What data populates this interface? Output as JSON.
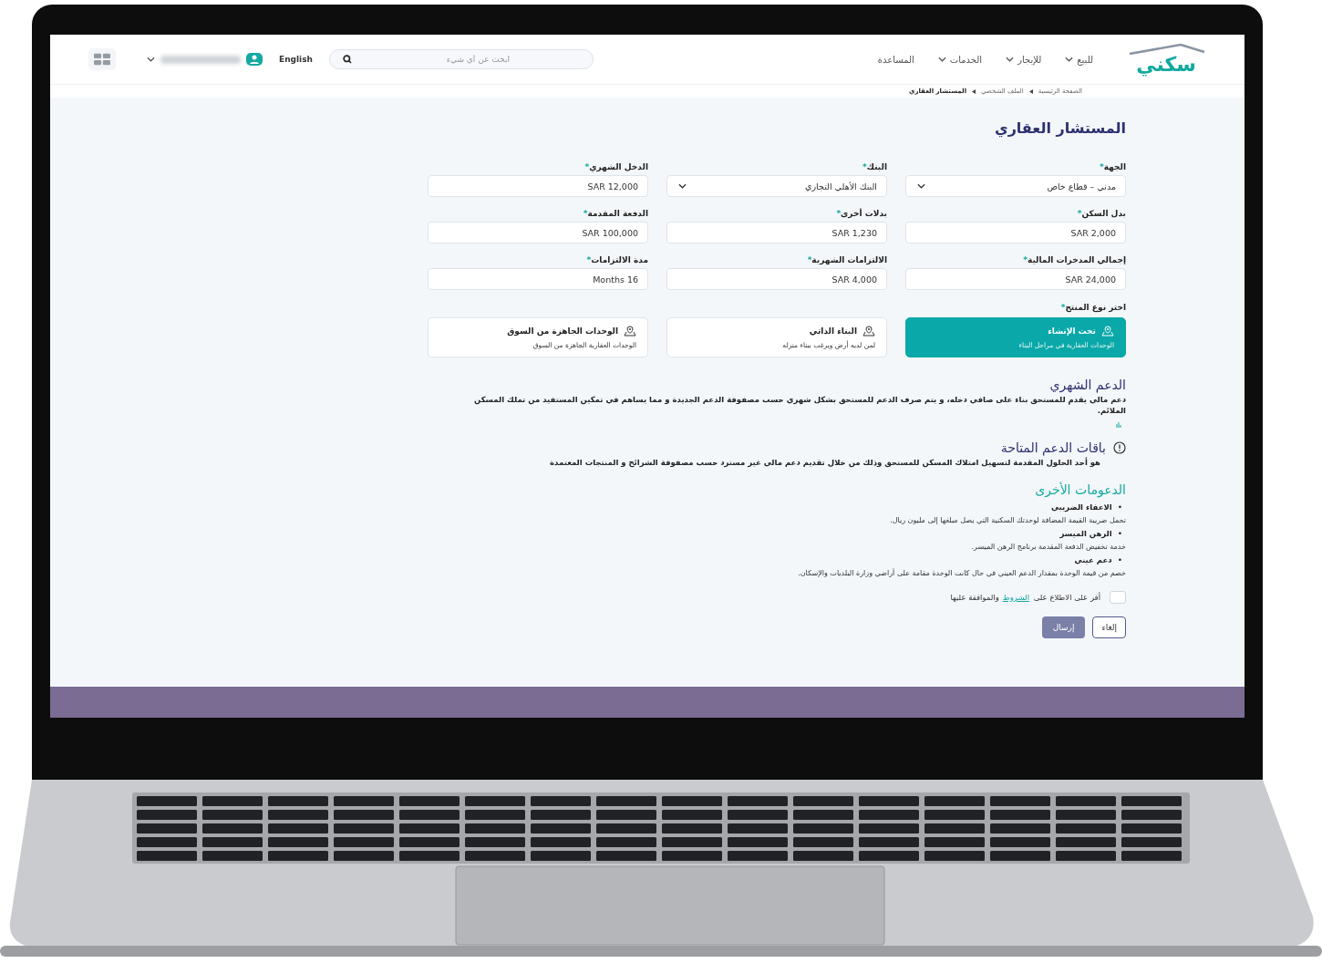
{
  "header": {
    "logo": "سكني",
    "nav": [
      {
        "label": "للبيع",
        "dropdown": true
      },
      {
        "label": "للإيجار",
        "dropdown": true
      },
      {
        "label": "الخدمات",
        "dropdown": true
      },
      {
        "label": "المساعدة",
        "dropdown": false
      }
    ],
    "search": {
      "placeholder": "ابحث عن أي شيء"
    },
    "language": "English"
  },
  "breadcrumb": [
    {
      "label": "الصفحة الرئيسية",
      "current": false
    },
    {
      "label": "الملف الشخصي",
      "current": false
    },
    {
      "label": "المستشار العقاري",
      "current": true
    }
  ],
  "title": "المستشار العقاري",
  "required_mark": "*",
  "fields": [
    {
      "label": "الجهة",
      "value": "مدني – قطاع خاص",
      "kind": "select"
    },
    {
      "label": "البنك",
      "value": "البنك الأهلي التجاري",
      "kind": "select"
    },
    {
      "label": "الدخل الشهري",
      "value": "SAR 12,000",
      "kind": "text"
    },
    {
      "label": "بدل السكن",
      "value": "SAR 2,000",
      "kind": "text"
    },
    {
      "label": "بدلات أخرى",
      "value": "SAR 1,230",
      "kind": "text"
    },
    {
      "label": "الدفعة المقدمة",
      "value": "SAR 100,000",
      "kind": "text"
    },
    {
      "label": "إجمالي المدخرات المالية",
      "value": "SAR 24,000",
      "kind": "text"
    },
    {
      "label": "الالتزامات الشهرية",
      "value": "SAR 4,000",
      "kind": "text"
    },
    {
      "label": "مدة الالتزامات",
      "value": "Months 16",
      "kind": "text"
    }
  ],
  "product_label": "اختر نوع المنتج",
  "products": [
    {
      "title": "تحت الإنشاء",
      "subtitle": "الوحدات العقارية في مراحل البناء",
      "selected": true
    },
    {
      "title": "البناء الذاتي",
      "subtitle": "لمن لديه أرض ويرغب ببناء منزله",
      "selected": false
    },
    {
      "title": "الوحدات الجاهزة من السوق",
      "subtitle": "الوحدات العقارية الجاهزة من السوق",
      "selected": false
    }
  ],
  "monthly_support": {
    "title": "الدعم الشهري",
    "text": "دعم مالي يقدم للمستحق بناء على صافي دخله، و يتم صرف الدعم للمستحق بشكل شهري حسب مصفوفة الدعم الجديدة و مما يساهم في تمكين المستفيد من تملك المسكن الملائم."
  },
  "packages": {
    "title": "باقات الدعم المتاحة",
    "text": "هو أحد الحلول المقدمة لتسهيل امتلاك المسكن للمستحق وذلك من خلال تقديم دعم مالي غير مسترد حسب مصفوفة الشرائح و المنتجات المعتمدة"
  },
  "other_support": {
    "title": "الدعومات الأخرى",
    "marker": "•",
    "items": [
      {
        "title": "الاعفاء الضريبي",
        "text": "تحمل ضريبة القيمة المضافة لوحدتك السكنية التي يصل مبلغها إلى مليون ريال."
      },
      {
        "title": "الرهن الميسر",
        "text": "خدمة تخفيض الدفعة المقدمة برنامج الرهن الميسر."
      },
      {
        "title": "دعم عيني",
        "text": "خصم من قيمة الوحدة بمقدار الدعم العيني في حال كانت الوحدة مقامة على أراضي وزارة البلديات والإسكان."
      }
    ]
  },
  "terms": {
    "checked": false,
    "before": "أقر على الاطلاع على ",
    "link": "الشروط",
    "after": "والموافقة عليها"
  },
  "buttons": {
    "submit": "إرسال",
    "cancel": "إلغاء"
  }
}
